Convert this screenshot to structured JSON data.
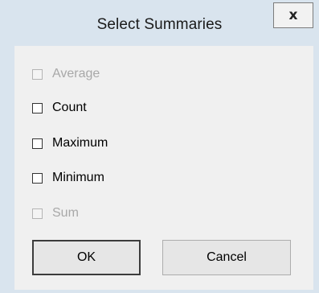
{
  "dialog": {
    "title": "Select Summaries",
    "close_label": "x"
  },
  "options": [
    {
      "label": "Average",
      "checked": false,
      "enabled": false
    },
    {
      "label": "Count",
      "checked": false,
      "enabled": true
    },
    {
      "label": "Maximum",
      "checked": false,
      "enabled": true
    },
    {
      "label": "Minimum",
      "checked": false,
      "enabled": true
    },
    {
      "label": "Sum",
      "checked": false,
      "enabled": false
    }
  ],
  "buttons": {
    "ok_label": "OK",
    "cancel_label": "Cancel"
  }
}
